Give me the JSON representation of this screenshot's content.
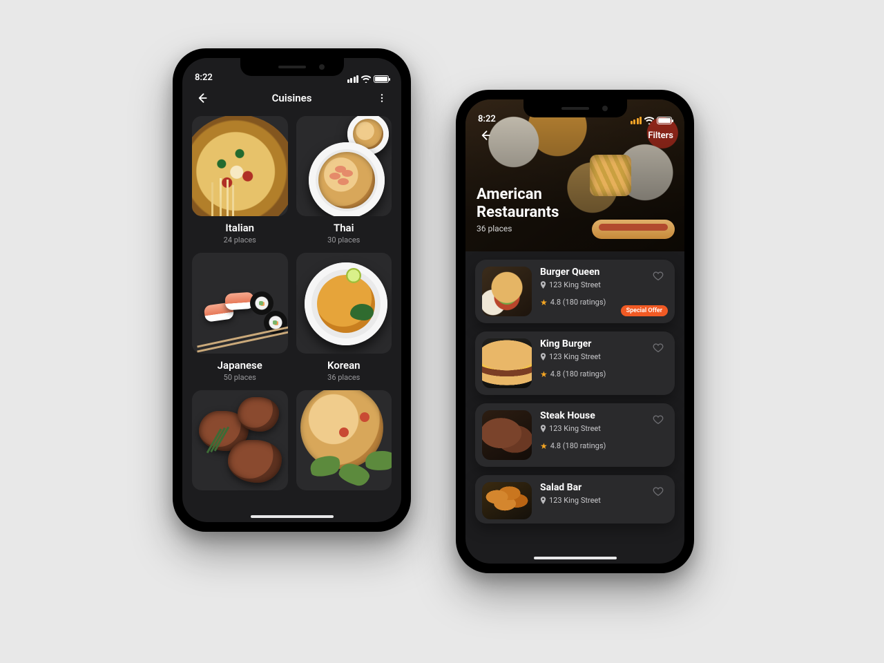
{
  "status": {
    "time": "8:22"
  },
  "left": {
    "title": "Cuisines",
    "tiles": [
      {
        "name": "Italian",
        "sub": "24 places"
      },
      {
        "name": "Thai",
        "sub": "30 places"
      },
      {
        "name": "Japanese",
        "sub": "50 places"
      },
      {
        "name": "Korean",
        "sub": "36 places"
      }
    ]
  },
  "right": {
    "filters": "Filters",
    "title_line1": "American",
    "title_line2": "Restaurants",
    "sub": "36 places",
    "badge": "Special Offer",
    "restaurants": [
      {
        "name": "Burger Queen",
        "addr": "123 King Street",
        "rating": "4.8 (180 ratings)"
      },
      {
        "name": "King Burger",
        "addr": "123 King Street",
        "rating": "4.8 (180 ratings)"
      },
      {
        "name": "Steak House",
        "addr": "123 King Street",
        "rating": "4.8 (180 ratings)"
      },
      {
        "name": "Salad Bar",
        "addr": "123 King Street",
        "rating": ""
      }
    ]
  }
}
